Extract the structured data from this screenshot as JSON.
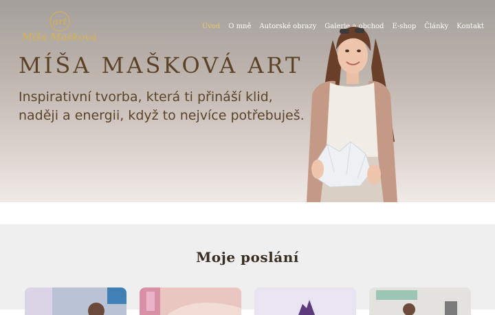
{
  "logo": {
    "art_text": "art",
    "name_text": "Míša Mašková",
    "color": "#d7b24f"
  },
  "nav": {
    "items": [
      {
        "label": "Úvod",
        "active": true
      },
      {
        "label": "O mně",
        "active": false
      },
      {
        "label": "Autorské obrazy",
        "active": false
      },
      {
        "label": "Galerie a obchod",
        "active": false
      },
      {
        "label": "E-shop",
        "active": false
      },
      {
        "label": "Články",
        "active": false
      },
      {
        "label": "Kontakt",
        "active": false
      }
    ],
    "active_color": "#e7c668"
  },
  "hero": {
    "title": "MÍŠA MAŠKOVÁ ART",
    "subtitle": "Inspirativní tvorba, která ti přináší klid, naději a energii, když to nejvíce potřebuješ."
  },
  "mission": {
    "title": "Moje poslání"
  },
  "colors": {
    "title_brown": "#5b4226",
    "section_bg": "#efefef"
  }
}
